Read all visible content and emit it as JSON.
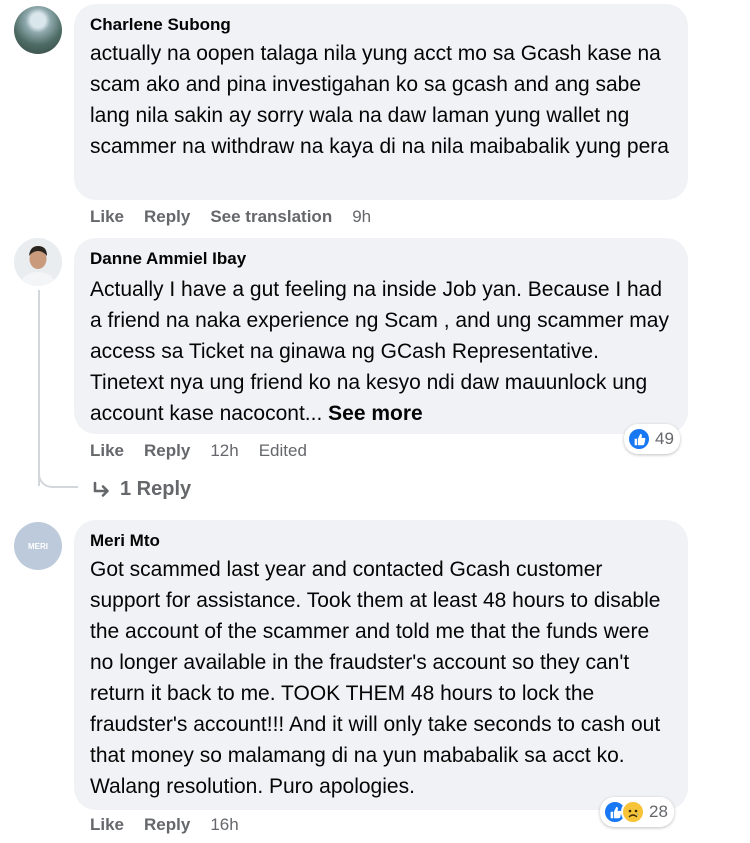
{
  "comments": [
    {
      "author": "Charlene Subong",
      "text": "actually na oopen talaga nila yung acct mo sa Gcash kase na scam ako and pina investigahan ko sa gcash and ang sabe lang nila sakin ay sorry wala na daw laman yung wallet ng scammer na withdraw na kaya di na nila maibabalik yung pera",
      "actions": {
        "like": "Like",
        "reply": "Reply",
        "translate": "See translation",
        "time": "9h"
      }
    },
    {
      "author": "Danne Ammiel Ibay",
      "text": "Actually I have a gut feeling na inside Job yan. Because I had a friend na naka experience ng Scam , and ung scammer may access sa Ticket na ginawa ng GCash Representative. Tinetext nya ung friend ko na kesyo ndi daw mauunlock ung account kase nacocont...",
      "see_more": "See more",
      "actions": {
        "like": "Like",
        "reply": "Reply",
        "time": "12h",
        "edited": "Edited"
      },
      "reactions": {
        "count": "49",
        "types": [
          "like-icon"
        ]
      },
      "replies_link": "1 Reply"
    },
    {
      "author": "Meri Mto",
      "avatar_text": "MERI",
      "text": "Got scammed last year and contacted Gcash customer support for assistance. Took them at least 48 hours to disable the account of the scammer and told me that the funds were no longer available in the fraudster's account so they can't return it back to me. TOOK THEM 48 hours to lock the fraudster's account!!! And it will only take seconds to cash out that money so malamang di na yun mababalik sa acct ko. Walang resolution. Puro apologies.",
      "actions": {
        "like": "Like",
        "reply": "Reply",
        "time": "16h"
      },
      "reactions": {
        "count": "28",
        "types": [
          "like-icon",
          "sad-icon"
        ]
      }
    }
  ],
  "colors": {
    "bubble": "#f0f2f5",
    "meta": "#65676b",
    "like_blue": "#1877f2",
    "sad_yellow": "#f7c338"
  }
}
